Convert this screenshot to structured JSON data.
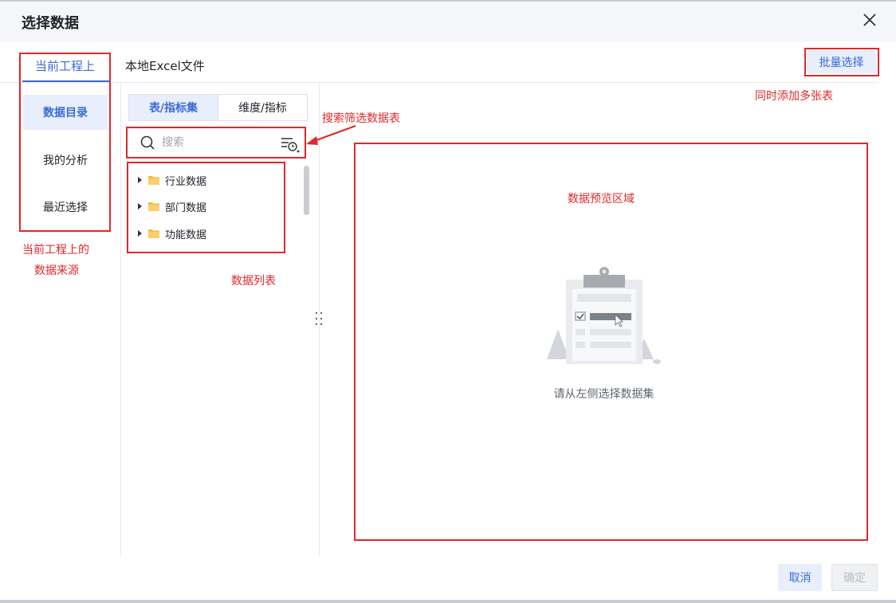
{
  "dialog": {
    "title": "选择数据"
  },
  "tabs": {
    "current": "当前工程上",
    "excel": "本地Excel文件"
  },
  "batch_select": "批量选择",
  "sidebar": {
    "items": [
      {
        "label": "数据目录"
      },
      {
        "label": "我的分析"
      },
      {
        "label": "最近选择"
      }
    ]
  },
  "subtabs": [
    {
      "label": "表/指标集"
    },
    {
      "label": "维度/指标"
    }
  ],
  "search": {
    "placeholder": "搜索"
  },
  "tree": [
    {
      "label": "行业数据"
    },
    {
      "label": "部门数据"
    },
    {
      "label": "功能数据"
    }
  ],
  "preview": {
    "empty_text": "请从左侧选择数据集"
  },
  "footer": {
    "cancel": "取消",
    "ok": "确定"
  },
  "annotations": {
    "source_line1": "当前工程上的",
    "source_line2": "数据来源",
    "search_filter": "搜索筛选数据表",
    "data_list": "数据列表",
    "preview_area": "数据预览区域",
    "batch_add": "同时添加多张表"
  },
  "colors": {
    "accent": "#3b6ad6",
    "annotation": "#e02828",
    "active_bg": "#e8eefb"
  }
}
